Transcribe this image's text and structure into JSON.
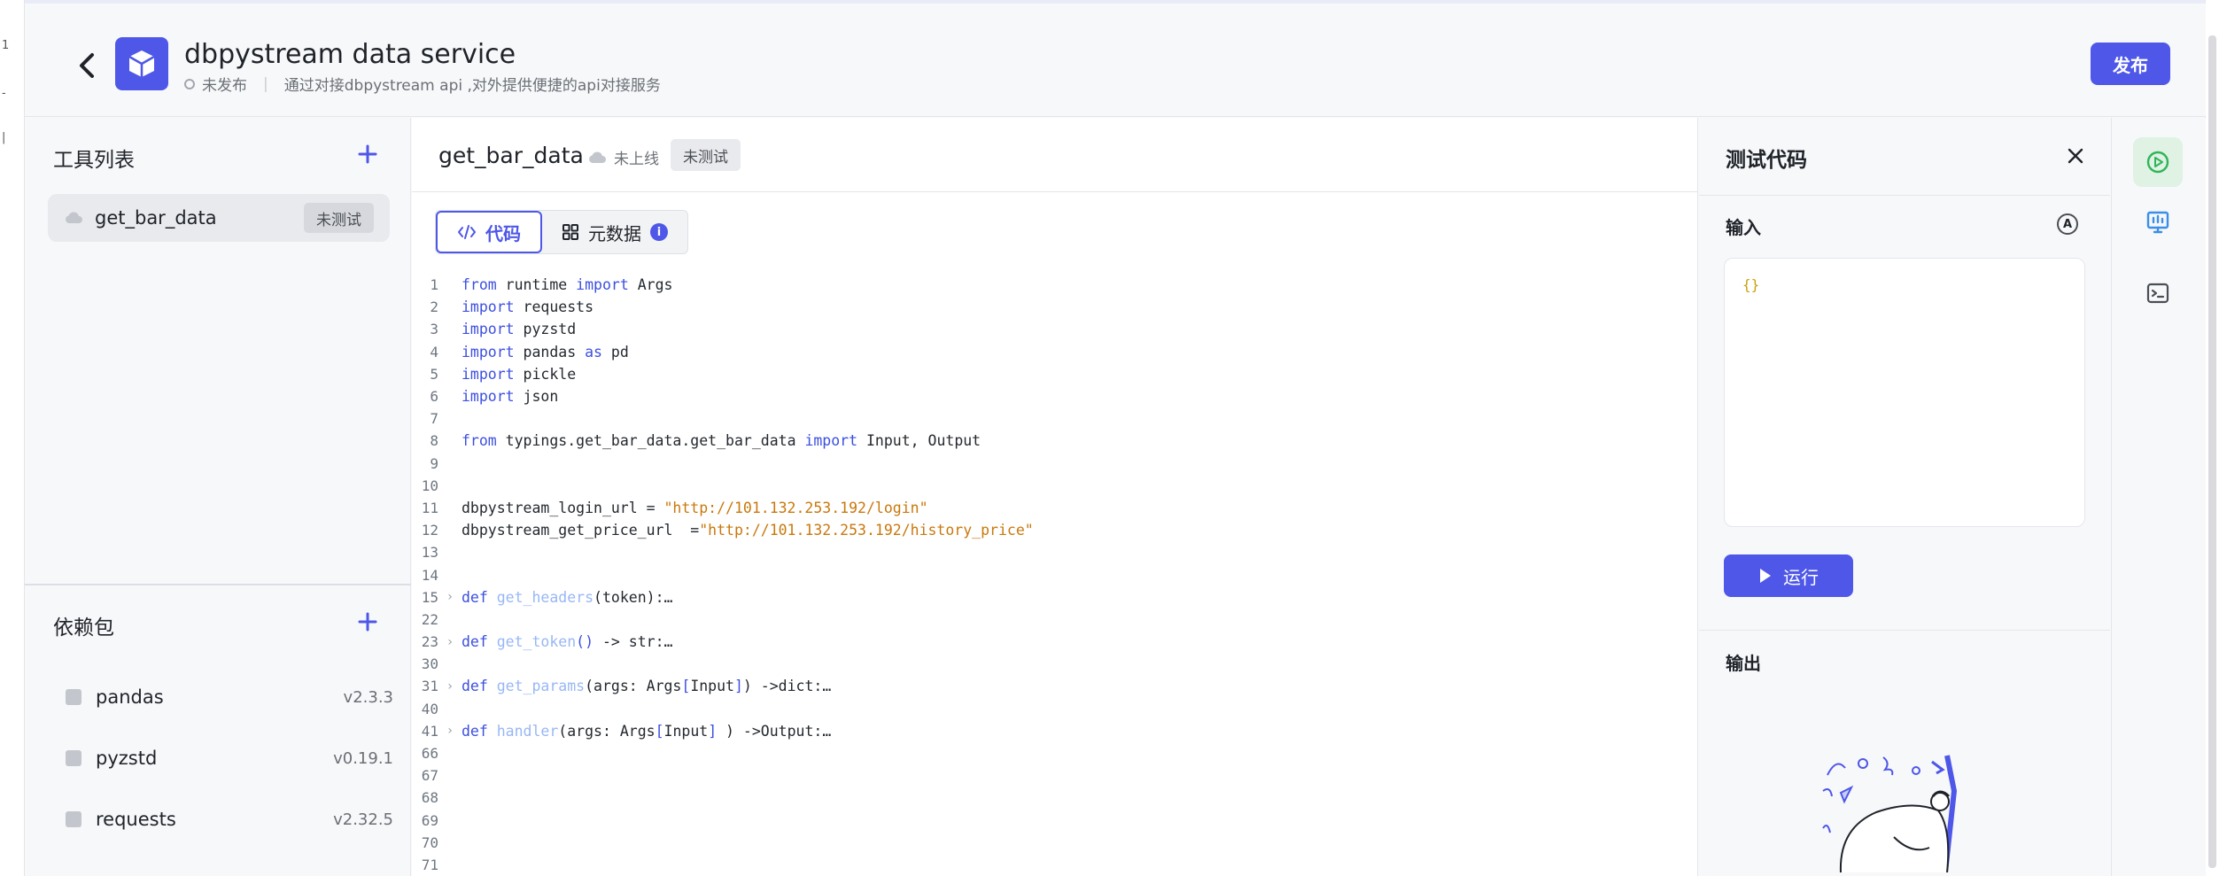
{
  "header": {
    "app_name": "dbpystream data service",
    "status": "未发布",
    "description": "通过对接dbpystream api ,对外提供便捷的api对接服务",
    "publish_label": "发布"
  },
  "tools": {
    "title": "工具列表",
    "items": [
      {
        "name": "get_bar_data",
        "badge": "未测试"
      }
    ]
  },
  "dependencies": {
    "title": "依赖包",
    "items": [
      {
        "name": "pandas",
        "version": "v2.3.3"
      },
      {
        "name": "pyzstd",
        "version": "v0.19.1"
      },
      {
        "name": "requests",
        "version": "v2.32.5"
      }
    ]
  },
  "editor": {
    "title": "get_bar_data",
    "online_status": "未上线",
    "test_status": "未测试",
    "tabs": [
      {
        "label": "代码",
        "icon": "code-icon"
      },
      {
        "label": "元数据",
        "icon": "grid-icon",
        "info": "i"
      }
    ],
    "lines": [
      {
        "n": "1",
        "fold": false,
        "tokens": [
          [
            "kw",
            "from"
          ],
          [
            "txt",
            " runtime "
          ],
          [
            "kw",
            "import"
          ],
          [
            "txt",
            " Args"
          ]
        ]
      },
      {
        "n": "2",
        "fold": false,
        "tokens": [
          [
            "kw",
            "import"
          ],
          [
            "txt",
            " requests"
          ]
        ]
      },
      {
        "n": "3",
        "fold": false,
        "tokens": [
          [
            "kw",
            "import"
          ],
          [
            "txt",
            " pyzstd"
          ]
        ]
      },
      {
        "n": "4",
        "fold": false,
        "tokens": [
          [
            "kw",
            "import"
          ],
          [
            "txt",
            " pandas "
          ],
          [
            "kw",
            "as"
          ],
          [
            "txt",
            " pd"
          ]
        ]
      },
      {
        "n": "5",
        "fold": false,
        "tokens": [
          [
            "kw",
            "import"
          ],
          [
            "txt",
            " pickle"
          ]
        ]
      },
      {
        "n": "6",
        "fold": false,
        "tokens": [
          [
            "kw",
            "import"
          ],
          [
            "txt",
            " json"
          ]
        ]
      },
      {
        "n": "7",
        "fold": false,
        "tokens": []
      },
      {
        "n": "8",
        "fold": false,
        "tokens": [
          [
            "kw",
            "from"
          ],
          [
            "txt",
            " typings.get_bar_data.get_bar_data "
          ],
          [
            "kw",
            "import"
          ],
          [
            "txt",
            " Input, Output"
          ]
        ]
      },
      {
        "n": "9",
        "fold": false,
        "tokens": []
      },
      {
        "n": "10",
        "fold": false,
        "tokens": []
      },
      {
        "n": "11",
        "fold": false,
        "tokens": [
          [
            "txt",
            "dbpystream_login_url = "
          ],
          [
            "str",
            "\"http://101.132.253.192/login\""
          ]
        ]
      },
      {
        "n": "12",
        "fold": false,
        "tokens": [
          [
            "txt",
            "dbpystream_get_price_url  ="
          ],
          [
            "str",
            "\"http://101.132.253.192/history_price\""
          ]
        ]
      },
      {
        "n": "13",
        "fold": false,
        "tokens": []
      },
      {
        "n": "14",
        "fold": false,
        "tokens": []
      },
      {
        "n": "15",
        "fold": true,
        "tokens": [
          [
            "kw",
            "def"
          ],
          [
            "txt",
            " "
          ],
          [
            "fn",
            "get_headers"
          ],
          [
            "txt",
            "(token):…"
          ]
        ]
      },
      {
        "n": "22",
        "fold": false,
        "tokens": []
      },
      {
        "n": "23",
        "fold": true,
        "tokens": [
          [
            "kw",
            "def"
          ],
          [
            "txt",
            " "
          ],
          [
            "fn",
            "get_token"
          ],
          [
            "kw",
            "()"
          ],
          [
            "txt",
            " -> str:…"
          ]
        ]
      },
      {
        "n": "30",
        "fold": false,
        "tokens": []
      },
      {
        "n": "31",
        "fold": true,
        "tokens": [
          [
            "kw",
            "def"
          ],
          [
            "txt",
            " "
          ],
          [
            "fn",
            "get_params"
          ],
          [
            "txt",
            "(args: Args"
          ],
          [
            "kw",
            "["
          ],
          [
            "txt",
            "Input"
          ],
          [
            "kw",
            "]"
          ],
          [
            "txt",
            ") ->dict:…"
          ]
        ]
      },
      {
        "n": "40",
        "fold": false,
        "tokens": []
      },
      {
        "n": "41",
        "fold": true,
        "tokens": [
          [
            "kw",
            "def"
          ],
          [
            "txt",
            " "
          ],
          [
            "fn",
            "handler"
          ],
          [
            "txt",
            "(args: Args"
          ],
          [
            "kw",
            "["
          ],
          [
            "txt",
            "Input"
          ],
          [
            "kw",
            "]"
          ],
          [
            "txt",
            " ) ->Output:…"
          ]
        ]
      },
      {
        "n": "66",
        "fold": false,
        "tokens": []
      },
      {
        "n": "67",
        "fold": false,
        "tokens": []
      },
      {
        "n": "68",
        "fold": false,
        "tokens": []
      },
      {
        "n": "69",
        "fold": false,
        "tokens": []
      },
      {
        "n": "70",
        "fold": false,
        "tokens": []
      },
      {
        "n": "71",
        "fold": false,
        "tokens": []
      }
    ]
  },
  "test_panel": {
    "title": "测试代码",
    "input_label": "输入",
    "auto_icon_letter": "A",
    "input_value": "{}",
    "run_label": "运行",
    "output_label": "输出"
  },
  "colors": {
    "accent": "#4e57e8",
    "keyword": "#3b4fe0",
    "function": "#98b7f5",
    "string": "#c9780c",
    "run_icon_active_bg": "#dff2e4"
  }
}
